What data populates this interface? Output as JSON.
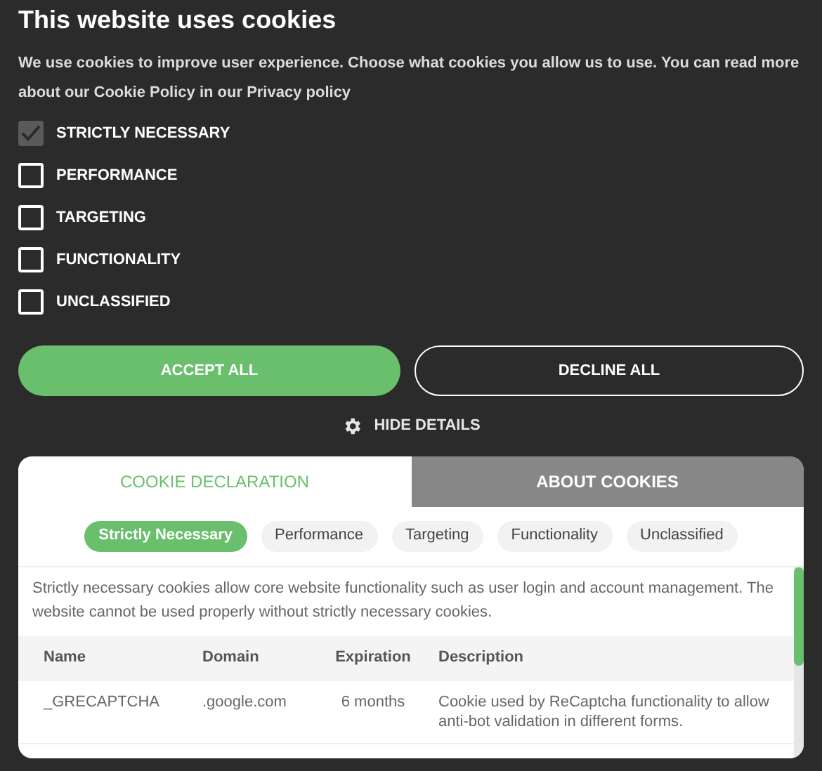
{
  "title": "This website uses cookies",
  "intro": "We use cookies to improve user experience. Choose what cookies you allow us to use. You can read more about our Cookie Policy in our Privacy policy",
  "categories": [
    {
      "label": "STRICTLY NECESSARY",
      "checked": true,
      "disabled": true
    },
    {
      "label": "PERFORMANCE",
      "checked": false,
      "disabled": false
    },
    {
      "label": "TARGETING",
      "checked": false,
      "disabled": false
    },
    {
      "label": "FUNCTIONALITY",
      "checked": false,
      "disabled": false
    },
    {
      "label": "UNCLASSIFIED",
      "checked": false,
      "disabled": false
    }
  ],
  "buttons": [
    {
      "label": "ACCEPT ALL",
      "kind": "primary"
    },
    {
      "label": "DECLINE ALL",
      "kind": "outline"
    }
  ],
  "details_toggle": "HIDE DETAILS",
  "tabs": [
    {
      "label": "COOKIE DECLARATION",
      "selected": true
    },
    {
      "label": "ABOUT COOKIES",
      "selected": false
    }
  ],
  "filters": [
    {
      "label": "Strictly Necessary",
      "selected": true
    },
    {
      "label": "Performance",
      "selected": false
    },
    {
      "label": "Targeting",
      "selected": false
    },
    {
      "label": "Functionality",
      "selected": false
    },
    {
      "label": "Unclassified",
      "selected": false
    }
  ],
  "category_description": "Strictly necessary cookies allow core website functionality such as user login and account management. The website cannot be used properly without strictly necessary cookies.",
  "table": {
    "columns": [
      "Name",
      "Domain",
      "Expiration",
      "Description"
    ],
    "rows": [
      [
        "_GRECAPTCHA",
        ".google.com",
        "6 months",
        "Cookie used by ReCaptcha functionality to allow anti-bot validation in different forms."
      ]
    ]
  }
}
